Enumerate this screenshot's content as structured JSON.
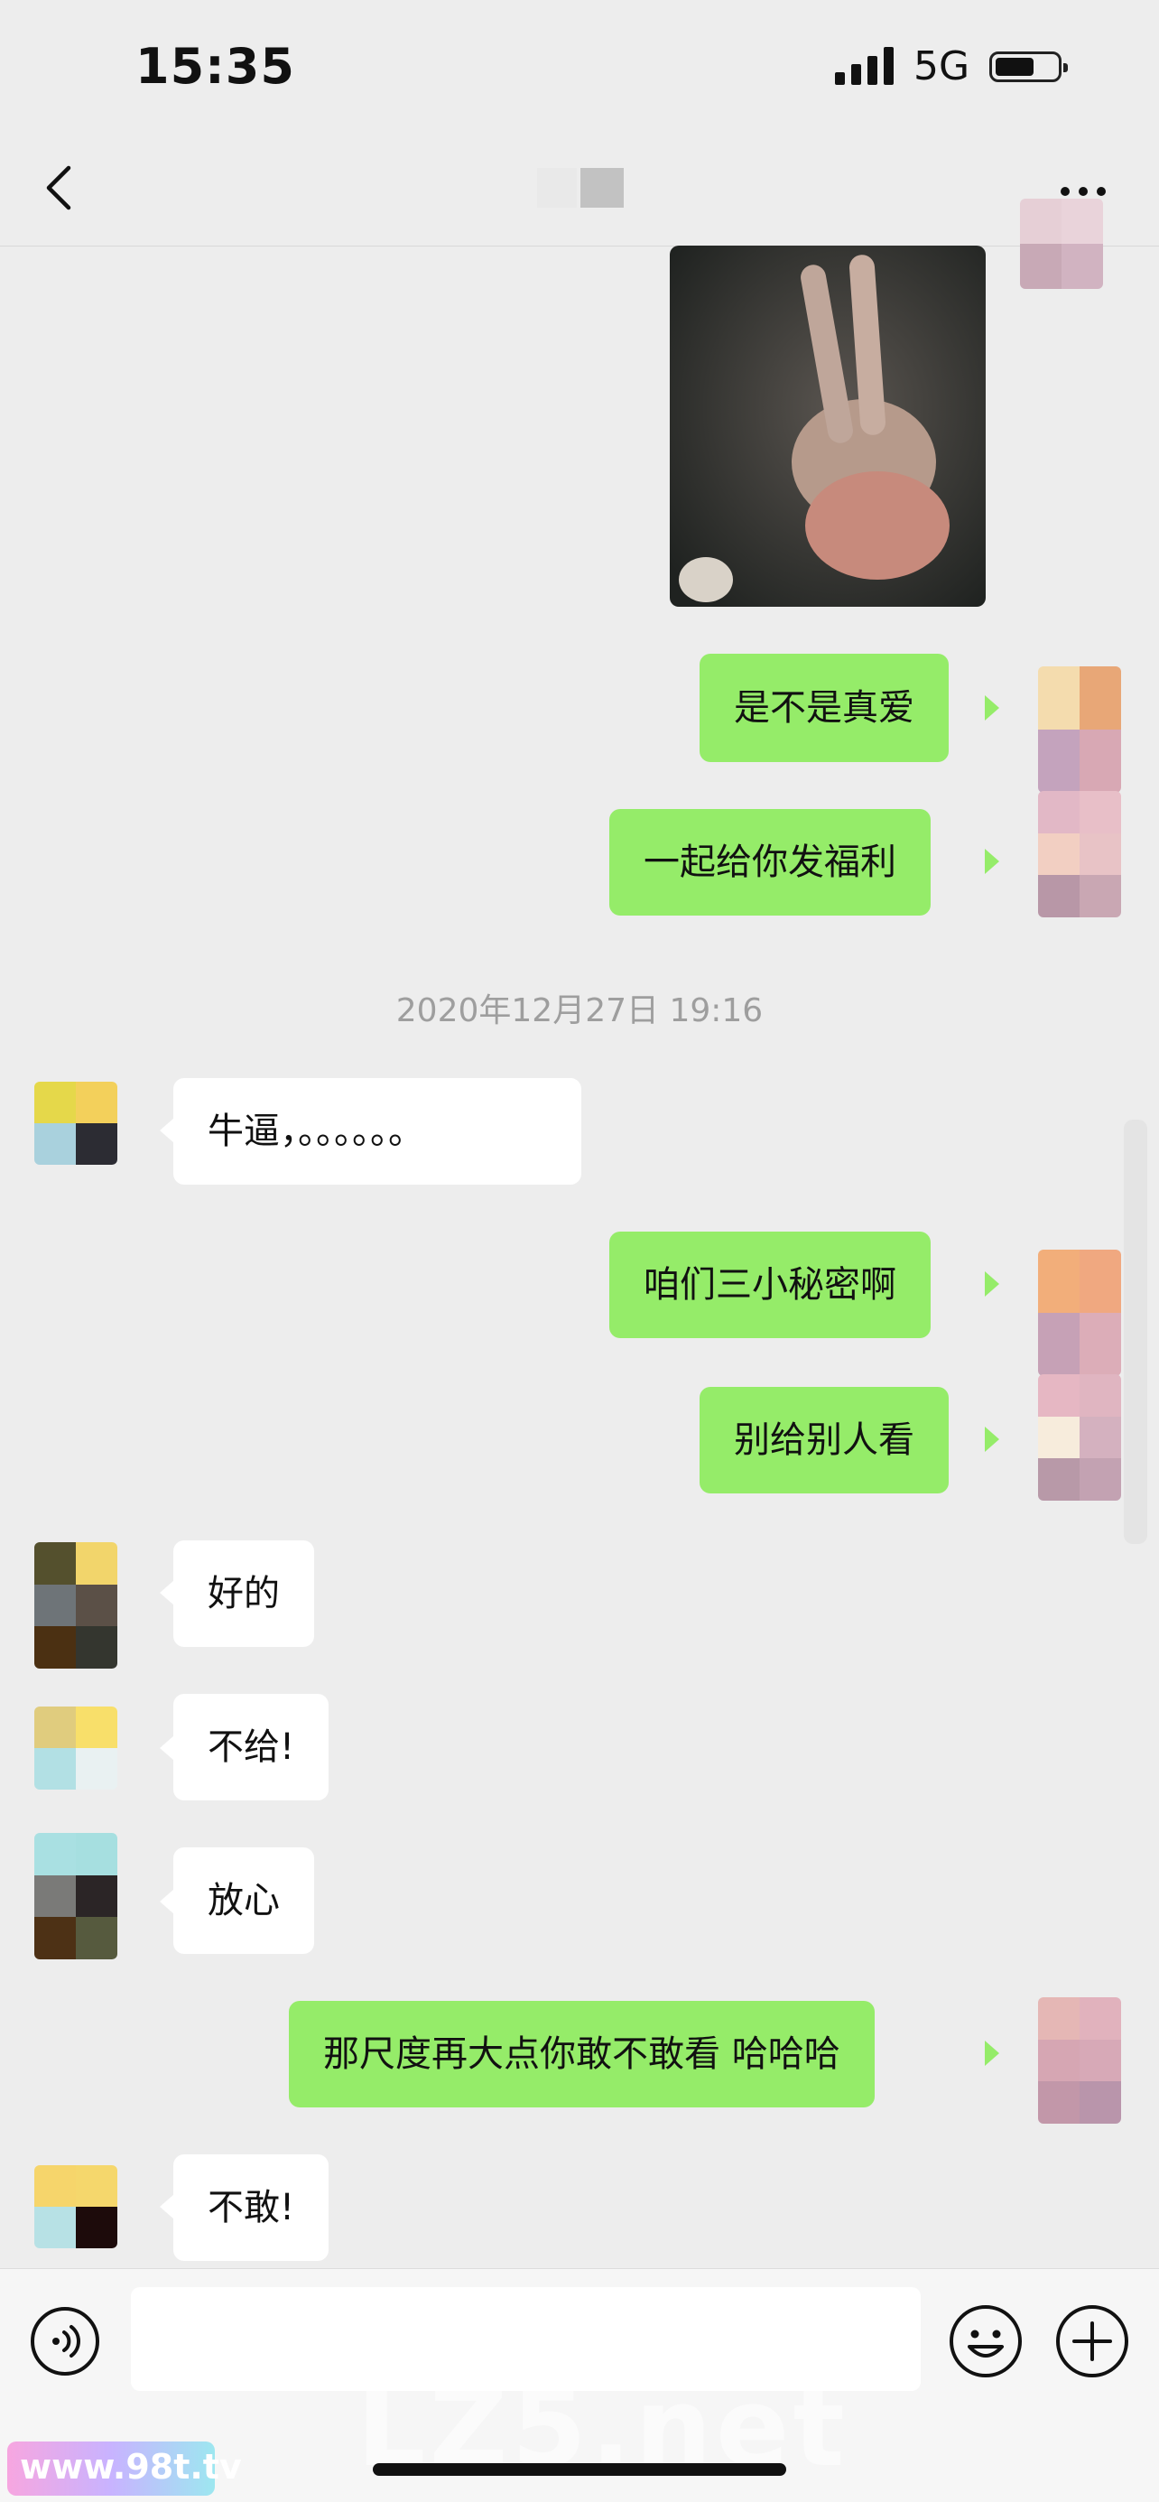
{
  "status_bar": {
    "time": "15:35",
    "network": "5G"
  },
  "nav": {
    "title": ""
  },
  "messages": {
    "m1": "是不是真爱",
    "m2": "一起给你发福利",
    "timestamp": "2020年12月27日 19:16",
    "m3": "牛逼，。。。。。。",
    "m4": "咱们三小秘密啊",
    "m5": "别给别人看",
    "m6": "好的",
    "m7": "不给!",
    "m8": "放心",
    "m9": "那尺度再大点你敢不敢看 哈哈哈",
    "m10": "不敢!"
  },
  "input": {
    "value": "",
    "placeholder": ""
  },
  "watermarks": {
    "main": "LZ5.net",
    "corner": "www.98t.tv"
  },
  "colors": {
    "outgoing_bubble": "#95ec69",
    "incoming_bubble": "#ffffff",
    "background": "#ededed"
  }
}
